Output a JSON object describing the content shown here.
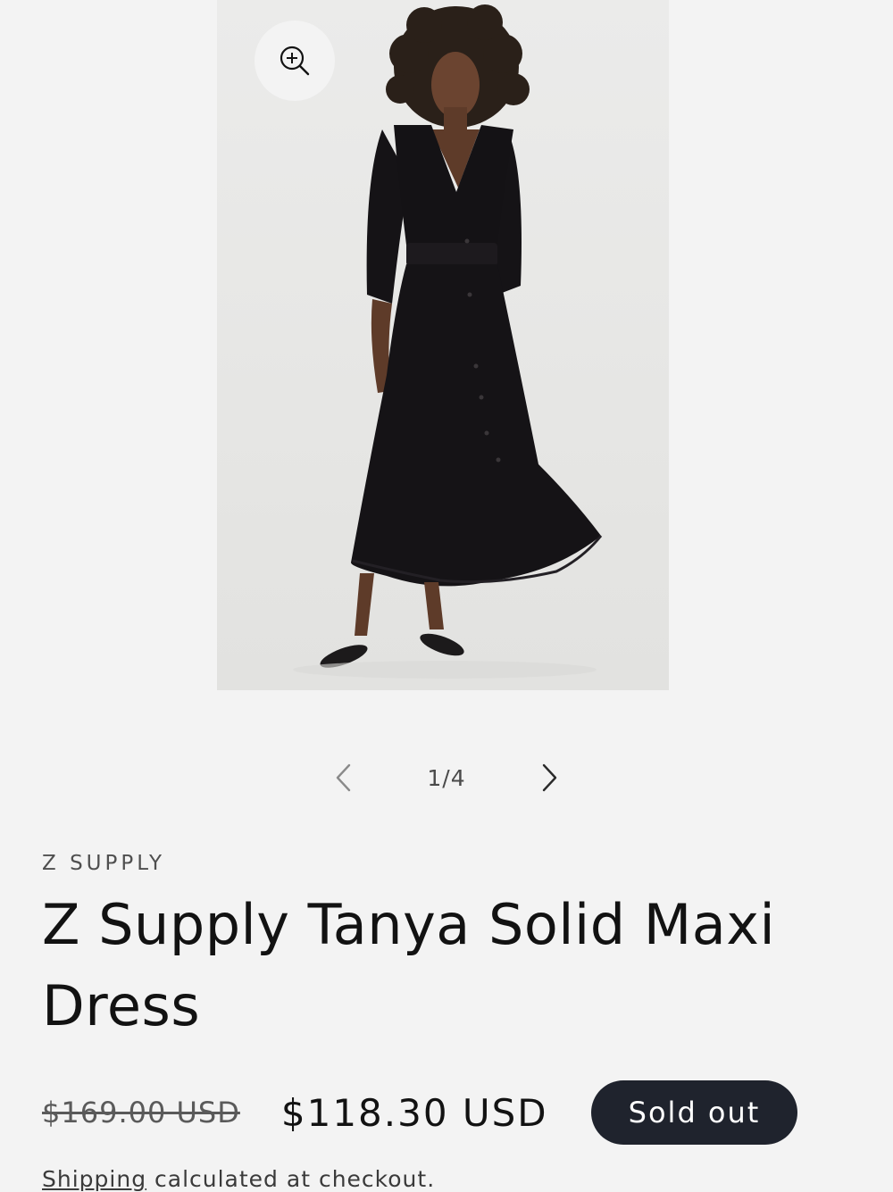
{
  "gallery": {
    "image_alt": "Z Supply Tanya Solid Maxi Dress",
    "zoom_icon": "zoom-in-icon",
    "counter": "1/4",
    "prev_icon": "chevron-left-icon",
    "next_icon": "chevron-right-icon"
  },
  "product": {
    "vendor": "Z SUPPLY",
    "title": "Z Supply Tanya Solid Maxi Dress",
    "compare_price": "$169.00 USD",
    "sale_price": "$118.30 USD",
    "badge": "Sold out",
    "shipping_link": "Shipping",
    "shipping_text": " calculated at checkout."
  },
  "colors": {
    "background": "#f3f3f3",
    "badge_bg": "#1f232d",
    "text": "#121212"
  }
}
